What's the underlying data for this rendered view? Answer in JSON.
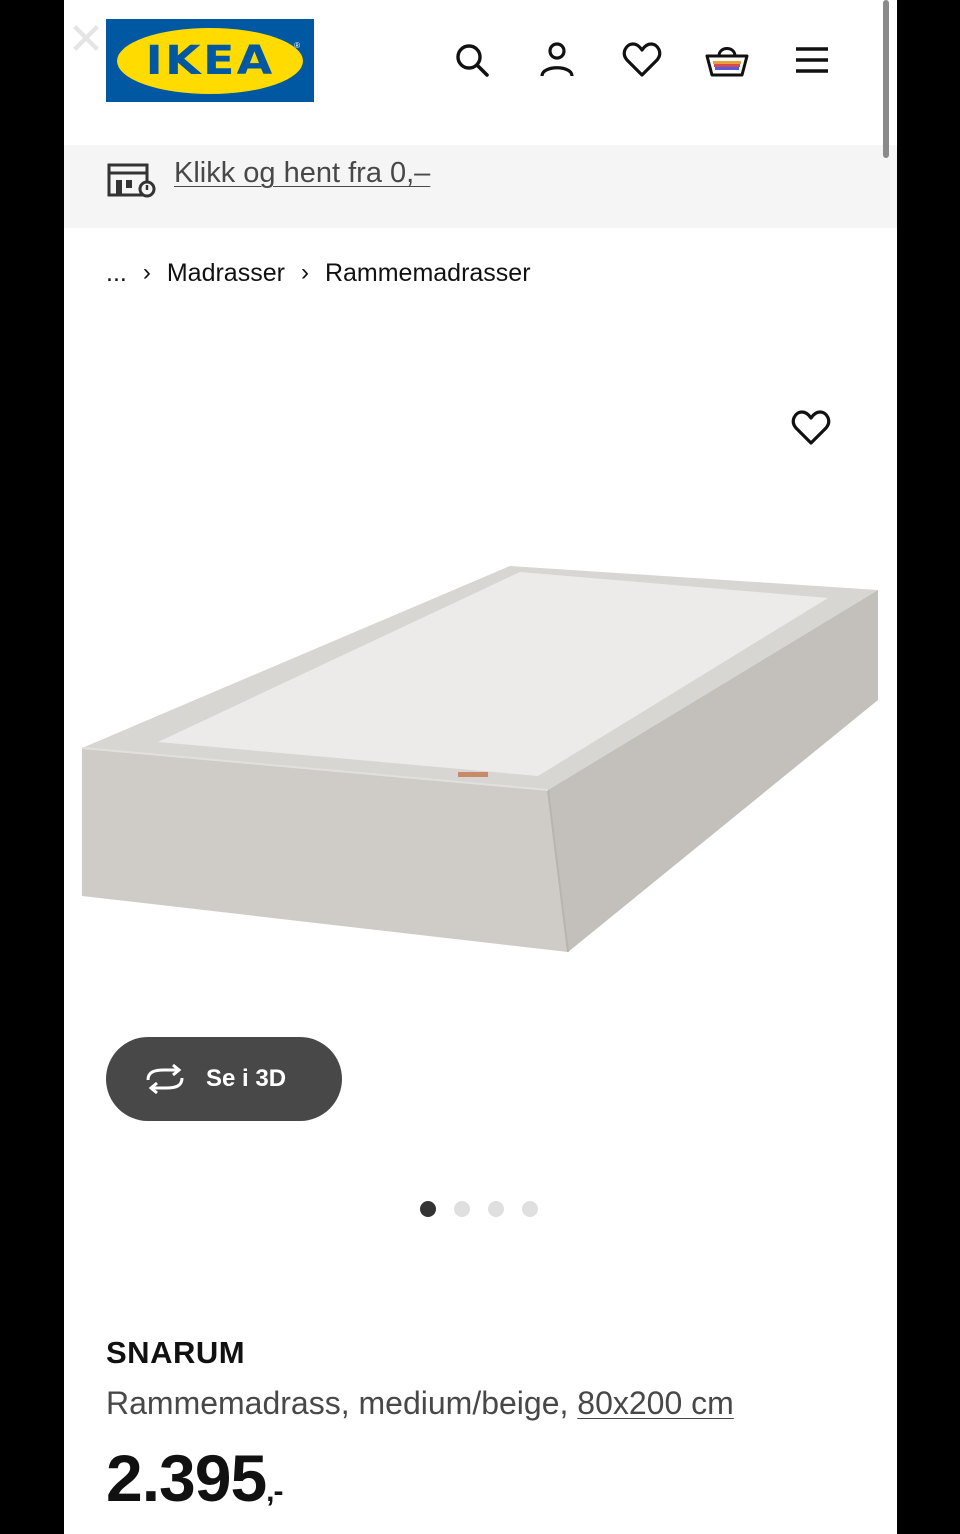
{
  "header": {
    "logo_text": "IKEA",
    "logo_registered": "®",
    "close_symbol": "✕",
    "icons": [
      "search-icon",
      "account-icon",
      "heart-icon",
      "basket-icon",
      "menu-icon"
    ]
  },
  "banner": {
    "link_text": "Klikk og hent fra 0,–"
  },
  "breadcrumb": {
    "ellipsis": "...",
    "separator": "›",
    "items": [
      "Madrasser",
      "Rammemadrasser"
    ]
  },
  "gallery": {
    "view_3d_label": "Se i 3D",
    "total_images": 4,
    "active_index": 0
  },
  "product": {
    "name": "SNARUM",
    "description": "Rammemadrass, medium/beige, ",
    "size": "80x200 cm",
    "price": "2.395",
    "price_suffix": ",-"
  },
  "colors": {
    "ikea_blue": "#0058a3",
    "ikea_yellow": "#ffdb00",
    "button_dark": "#484848",
    "banner_bg": "#f5f5f5"
  }
}
